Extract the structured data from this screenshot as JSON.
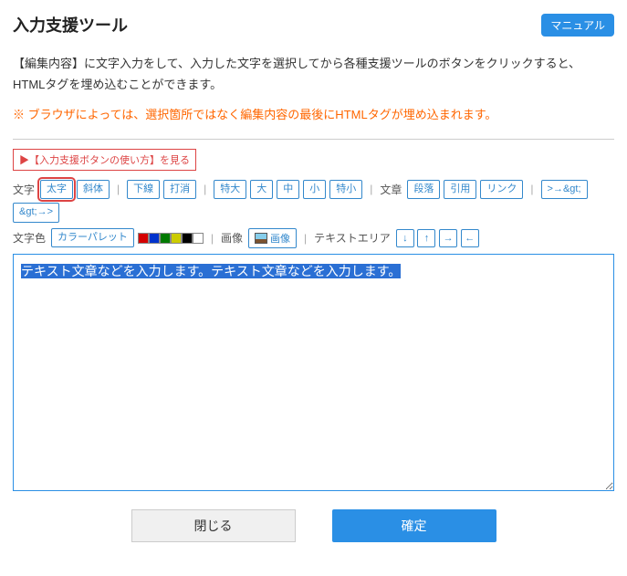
{
  "header": {
    "title": "入力支援ツール",
    "manual_label": "マニュアル"
  },
  "description": "【編集内容】に文字入力をして、入力した文字を選択してから各種支援ツールのボタンをクリックすると、\nHTMLタグを埋め込むことができます。",
  "warning": "※ ブラウザによっては、選択箇所ではなく編集内容の最後にHTMLタグが埋め込まれます。",
  "help_link": "▶【入力支援ボタンの使い方】を見る",
  "toolbar": {
    "row1": {
      "label_moji": "文字",
      "bold": "太字",
      "italic": "斜体",
      "underline": "下線",
      "strike": "打消",
      "xlarge": "特大",
      "large": "大",
      "medium": "中",
      "small": "小",
      "xsmall": "特小",
      "label_bunsho": "文章",
      "paragraph": "段落",
      "quote": "引用",
      "link": "リンク",
      "gt1": ">→&gt;",
      "gt2": "&gt;→>"
    },
    "row2": {
      "label_color": "文字色",
      "palette": "カラーパレット",
      "swatches": [
        "#d40000",
        "#0033cc",
        "#007a00",
        "#cccc00",
        "#000000",
        "#ffffff"
      ],
      "label_image": "画像",
      "image_btn": "画像",
      "label_textarea": "テキストエリア",
      "arrows": [
        "↓",
        "↑",
        "→",
        "←"
      ]
    }
  },
  "editor_text": "テキスト文章などを入力します。テキスト文章などを入力します。",
  "footer": {
    "close": "閉じる",
    "confirm": "確定"
  }
}
